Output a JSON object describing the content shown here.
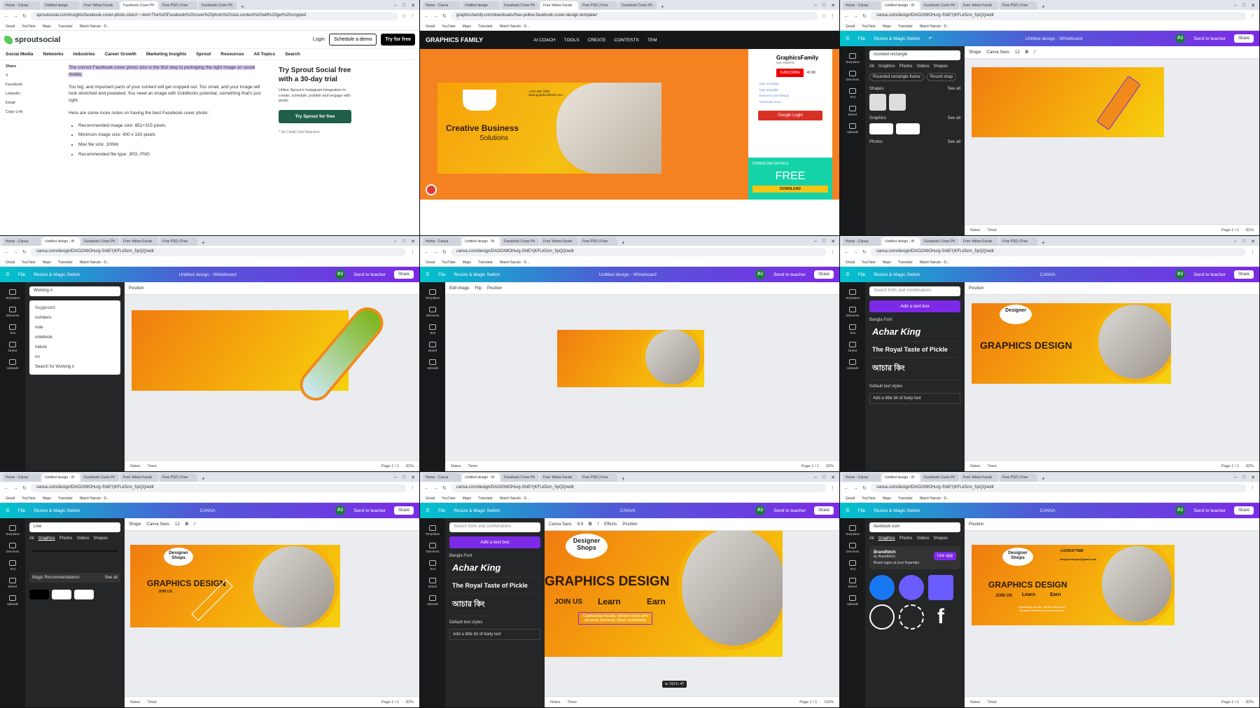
{
  "tabs": {
    "w1": [
      "Home - Canva",
      "Untitled design",
      "Free Yellow Faceb",
      "Facebook Cover Ph",
      "Free PSD | Free",
      "Facebook Cover Ph"
    ],
    "w2": [
      "Home - Canva",
      "Untitled design - W",
      "Facebook Cover Ph",
      "Free Yellow Faceb",
      "Free PSD | Free",
      "Facebook Cover Ph"
    ],
    "w3": [
      "Home - Canva",
      "Untitled design - W",
      "Facebook Cover Ph",
      "Free Yellow Faceb",
      "Free PSD | Free"
    ]
  },
  "urls": {
    "sprout": "sproutsocial.com/insights/facebook-cover-photo-size/#:~:text=The%20Facebook%20cover%20photo%20size,content%20will%20get%20cropped",
    "gf": "graphicsfamily.com/downloads/free-yellow-facebook-cover-design-template/",
    "canva": "canva.com/design/DAGOh9OHu/g-ShiEYjKFLk5zm_5pQQ/edit"
  },
  "bookmarks": [
    "Gmail",
    "YouTube",
    "Maps",
    "Translate",
    "Watch Naruto - D..."
  ],
  "sprout": {
    "brand": "sproutsocial",
    "login": "Login",
    "demo": "Schedule a demo",
    "try": "Try for free",
    "nav": [
      "Social Media",
      "Networks",
      "Industries",
      "Career Growth",
      "Marketing Insights",
      "Sprout",
      "Resources",
      "All Topics",
      "Search"
    ],
    "share_title": "Share",
    "share": [
      "X",
      "Facebook",
      "LinkedIn",
      "Email",
      "Copy Link"
    ],
    "p1": "The correct Facebook cover photo size is the first step to portraying the right image on social media.",
    "p2": "Too big, and important parts of your content will get cropped out. Too small, and your image will look stretched and pixelated. You need an image with Goldilocks potential, something that's just right.",
    "p3": "Here are some more notes on having the best Facebook cover photo:",
    "bullets": [
      "Recommended image size: 851×315 pixels",
      "Minimum image size: 400 x 150 pixels",
      "Max file size: 100kb",
      "Recommended file type: JPG, PNG"
    ],
    "promo_title": "Try Sprout Social free with a 30-day trial",
    "promo_text": "Utilize Sprout's Instagram integration to create, schedule, publish and engage with posts.",
    "promo_cta": "Try Sprout for free",
    "promo_note": "* No Credit Card Required"
  },
  "gf": {
    "brand": "GRAPHICS FAMILY",
    "nav": [
      "AI COACH",
      "TOOLS",
      "CREATE",
      "CONTESTS",
      "TEM"
    ],
    "banner_title": "Creative Business",
    "banner_sub": "Solutions",
    "banner_phone": "+123 456 7890",
    "banner_web": "www.graphicsfamily.com",
    "side_name": "GraphicsFamily",
    "side_videos": "530 VIDEOS",
    "subscribe": "SUBSCRIBE",
    "subs": "40.9K",
    "links": [
      "logo mockups",
      "logo template",
      "business card design",
      "facebook cover"
    ],
    "google": "Google Login",
    "dl_title": "DOWNLOAD DETAILS",
    "dl_free": "FREE",
    "dl_btn": "DOWNLOAD"
  },
  "canva": {
    "file": "File",
    "resize": "Resize & Magic Switch",
    "title_untitled": "Untitled design - Whiteboard",
    "title_canva": "CANVA",
    "avatar": "PJ",
    "send": "Send to teacher",
    "share": "Share",
    "rail": [
      "Templates",
      "Elements",
      "Text",
      "Brand",
      "Uploads",
      "Draw"
    ],
    "notes": "Notes",
    "timer": "Timer",
    "page": "Page 1 / 1",
    "zoom": [
      "81%",
      "81%",
      "52%",
      "82%",
      "82%",
      "116%",
      "82%"
    ],
    "search_rr": "rounded rectangle",
    "search_working": "Working n",
    "search_fonts": "Search fonts and combinations",
    "search_line": "Line",
    "search_fb": "facebook icon",
    "cats": [
      "All",
      "Graphics",
      "Photos",
      "Videos",
      "Shapes"
    ],
    "rr_chips": [
      "Rounded rectangle frame",
      "Round shap"
    ],
    "shapes": "Shapes",
    "graphics": "Graphics",
    "photos": "Photos",
    "see_all": "See all",
    "suggested": "Suggested",
    "suggestions": [
      "numbers",
      "note",
      "notebook",
      "nature",
      "no"
    ],
    "search_for": "Search for Working n",
    "add_text": "Add a text box",
    "bangla": "Bangla Font",
    "fonts": [
      "Achar King",
      "The Royal Taste of Pickle",
      "আচার কিং"
    ],
    "default_styles": "Default text styles",
    "body_text": "Add a little bit of body text",
    "magic": "Magic Recommendations",
    "brandfetch": "Brandfetch",
    "brandfetch_by": "by Brandfetch",
    "brandfetch_desc": "Brand logos at your fingertips",
    "use_app": "Use app",
    "position": "Position",
    "edit_image": "Edit image",
    "flip": "Flip",
    "shape": "Shape",
    "font": "Canva Sans",
    "font_size": "12",
    "font_size2": "8.9",
    "effects": "Effects",
    "wh": "w: 213 h: 47"
  },
  "design": {
    "brand_top": "Designer",
    "brand_bottom": "Shops",
    "headline": "GRAPHICS DESIGN",
    "join": "JOIN US",
    "learn": "Learn",
    "earn": "Earn",
    "tagline": "Captivating visuals, vibrant colors and dynamic elements blend seamlessly",
    "phone": "+12455477888",
    "email": "designershops@gmail.com"
  },
  "colors": {
    "canva_purple": "#7d2ae8",
    "orange": "#f58220",
    "yellow": "#f6d20e"
  }
}
